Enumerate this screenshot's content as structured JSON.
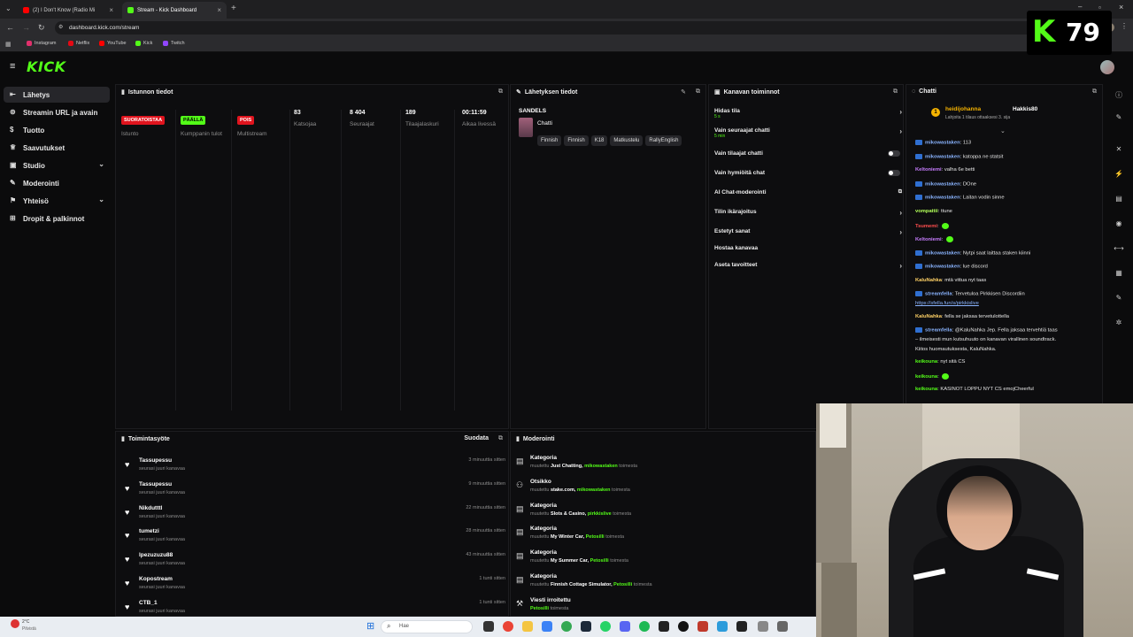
{
  "browser": {
    "tabs": [
      {
        "title": "(2) I Don't Know (Radio Mi",
        "active": false
      },
      {
        "title": "Stream - Kick Dashboard",
        "active": true
      }
    ],
    "url": "dashboard.kick.com/stream",
    "bookmarks": [
      "Instagram",
      "Netflix",
      "YouTube",
      "Kick",
      "Twitch"
    ]
  },
  "overlay": {
    "viewer_count": "79"
  },
  "kick": {
    "logo": "KICK"
  },
  "sidebar": {
    "items": [
      {
        "label": "Lähetys",
        "icon": "broadcast-icon"
      },
      {
        "label": "Streamin URL ja avain",
        "icon": "key-icon"
      },
      {
        "label": "Tuotto",
        "icon": "dollar-icon"
      },
      {
        "label": "Saavutukset",
        "icon": "trophy-icon"
      },
      {
        "label": "Studio",
        "icon": "studio-icon"
      },
      {
        "label": "Moderointi",
        "icon": "wrench-icon"
      },
      {
        "label": "Yhteisö",
        "icon": "community-icon"
      },
      {
        "label": "Dropit & palkinnot",
        "icon": "gift-icon"
      }
    ]
  },
  "session": {
    "title": "Istunnon tiedot",
    "stats": [
      {
        "value": "SUORATOISTAA",
        "label": "Istunto"
      },
      {
        "value": "PÄÄLLÄ",
        "label": "Kumppanin tulot"
      },
      {
        "value": "POIS",
        "label": "Multistream"
      },
      {
        "value": "83",
        "label": "Katsojaa"
      },
      {
        "value": "8 404",
        "label": "Seuraajat"
      },
      {
        "value": "189",
        "label": "Tilaajalaskuri"
      },
      {
        "value": "00:11:59",
        "label": "Aikaa livessä"
      }
    ]
  },
  "broadcast": {
    "title": "Lähetyksen tiedot",
    "stream_title": "SANDELS",
    "category": "Chatti",
    "tags": [
      "Finnish",
      "Finnish",
      "K18",
      "Matkustelu",
      "RallyEnglish"
    ]
  },
  "channel_actions": {
    "title": "Kanavan toiminnot",
    "items": [
      {
        "label": "Hidas tila",
        "sub": "5 s"
      },
      {
        "label": "Vain seuraajat chatti",
        "sub": "5 min"
      },
      {
        "label": "Vain tilaajat chatti",
        "sub": ""
      },
      {
        "label": "Vain hymiöitä chat",
        "sub": ""
      },
      {
        "label": "AI Chat-moderointi",
        "sub": ""
      },
      {
        "label": "Tilin ikärajoitus",
        "sub": ""
      },
      {
        "label": "Estetyt sanat",
        "sub": ""
      },
      {
        "label": "Hostaa kanavaa",
        "sub": ""
      },
      {
        "label": "Aseta tavoitteet",
        "sub": ""
      }
    ]
  },
  "chat": {
    "title": "Chatti",
    "gift": {
      "user": "heidijohanna",
      "target": "Hakkis80",
      "text": "Lahjoita 1 tilaus ottaaksesi 3. sija"
    },
    "messages": [
      {
        "user": "mikowastaken",
        "text": "113",
        "color": "#8ab4ff",
        "mod": true
      },
      {
        "user": "mikowastaken",
        "text": "katoppa ne statsit",
        "color": "#8ab4ff",
        "mod": true
      },
      {
        "user": "Keltoniemi",
        "text": "valha 6e betti",
        "color": "#c77dff",
        "mod": false
      },
      {
        "user": "mikowastaken",
        "text": "DOne",
        "color": "#8ab4ff",
        "mod": true
      },
      {
        "user": "mikowastaken",
        "text": "Laitan vodin sinne",
        "color": "#8ab4ff",
        "mod": true
      },
      {
        "user": "vompattii",
        "text": "ttune",
        "color": "#b2ff59",
        "mod": false
      },
      {
        "user": "Tsumemi",
        "text": "",
        "color": "#ff4d4d",
        "mod": false
      },
      {
        "user": "Keltoniemi",
        "text": "",
        "color": "#c77dff",
        "mod": false
      },
      {
        "user": "mikowastaken",
        "text": "Nytpi saat laittaa staken kiinni",
        "color": "#8ab4ff",
        "mod": true
      },
      {
        "user": "mikowastaken",
        "text": "lue discord",
        "color": "#8ab4ff",
        "mod": true
      },
      {
        "user": "KaluNahka",
        "text": "mtä vittua nyt taas",
        "color": "#ffd166",
        "mod": false
      },
      {
        "user": "streamfella",
        "text": "Tervetuloa Pirkkisen Discordiin",
        "color": "#8ab4ff",
        "mod": true
      },
      {
        "user": "",
        "text": "https://sfella.fun/s/pirkkislive",
        "color": "#8ab4ff",
        "mod": false
      },
      {
        "user": "KaluNahka",
        "text": "fella se jaksaa tervetulottella",
        "color": "#ffd166",
        "mod": false
      },
      {
        "user": "streamfella",
        "text": "@KaluNahka Jep. Fella jaksaa tervehtiä taas",
        "color": "#8ab4ff",
        "mod": true
      },
      {
        "user": "",
        "text": "– ilmeisesti mun kutsuhuuto on kanavan virallinen soundtrack.",
        "color": "#e6e6e6",
        "mod": false
      },
      {
        "user": "",
        "text": "Kiitos huomautuksesta, KaluNahka.",
        "color": "#e6e6e6",
        "mod": false
      },
      {
        "user": "keikouna",
        "text": "nyt sitä CS",
        "color": "#53fc18",
        "mod": false
      },
      {
        "user": "keikouna",
        "text": "",
        "color": "#53fc18",
        "mod": false
      },
      {
        "user": "keikouna",
        "text": "KASINOT LOPPU NYT CS emojCheerful",
        "color": "#53fc18",
        "mod": false
      }
    ]
  },
  "activity": {
    "title": "Toimintasyöte",
    "filter": "Suodata",
    "items": [
      {
        "name": "Tassupessu",
        "sub": "seurasi juuri kanavaa",
        "time": "3 minuuttia sitten"
      },
      {
        "name": "Tassupessu",
        "sub": "seurasi juuri kanavaa",
        "time": "9 minuuttia sitten"
      },
      {
        "name": "Nikdutttl",
        "sub": "seurasi juuri kanavaa",
        "time": "22 minuuttia sitten"
      },
      {
        "name": "tumetzi",
        "sub": "seurasi juuri kanavaa",
        "time": "28 minuuttia sitten"
      },
      {
        "name": "lpezuzuzu88",
        "sub": "seurasi juuri kanavaa",
        "time": "43 minuuttia sitten"
      },
      {
        "name": "Kopostream",
        "sub": "seurasi juuri kanavaa",
        "time": "1 tunti sitten"
      },
      {
        "name": "CTB_1",
        "sub": "seurasi juuri kanavaa",
        "time": "1 tunti sitten"
      }
    ]
  },
  "moderation": {
    "title": "Moderointi",
    "items": [
      {
        "title": "Kategoria",
        "pre": "muutettu",
        "value": "Just Chatting,",
        "by": "mikowastaken",
        "post": "toimesta"
      },
      {
        "title": "Otsikko",
        "pre": "muutettu",
        "value": "stake.com,",
        "by": "mikowastaken",
        "post": "toimesta"
      },
      {
        "title": "Kategoria",
        "pre": "muutettu",
        "value": "Slots & Casino,",
        "by": "pirkkislive",
        "post": "toimesta"
      },
      {
        "title": "Kategoria",
        "pre": "muutettu",
        "value": "My Winter Car,",
        "by": "Petosilli",
        "post": "toimesta"
      },
      {
        "title": "Kategoria",
        "pre": "muutettu",
        "value": "My Summer Car,",
        "by": "Petosilli",
        "post": "toimesta"
      },
      {
        "title": "Kategoria",
        "pre": "muutettu",
        "value": "Finnish Cottage Simulator,",
        "by": "Petosilli",
        "post": "toimesta"
      },
      {
        "title": "Viesti irroitettu",
        "pre": "",
        "value": "",
        "by": "Petosilli",
        "post": "toimesta"
      }
    ]
  },
  "taskbar": {
    "weather": "2°C",
    "weather_sub": "Pilvistä",
    "search": "Hae"
  },
  "colors": {
    "accent": "#53fc18",
    "live_red": "#e0141e",
    "chat_mod": "#2f6fd1"
  }
}
